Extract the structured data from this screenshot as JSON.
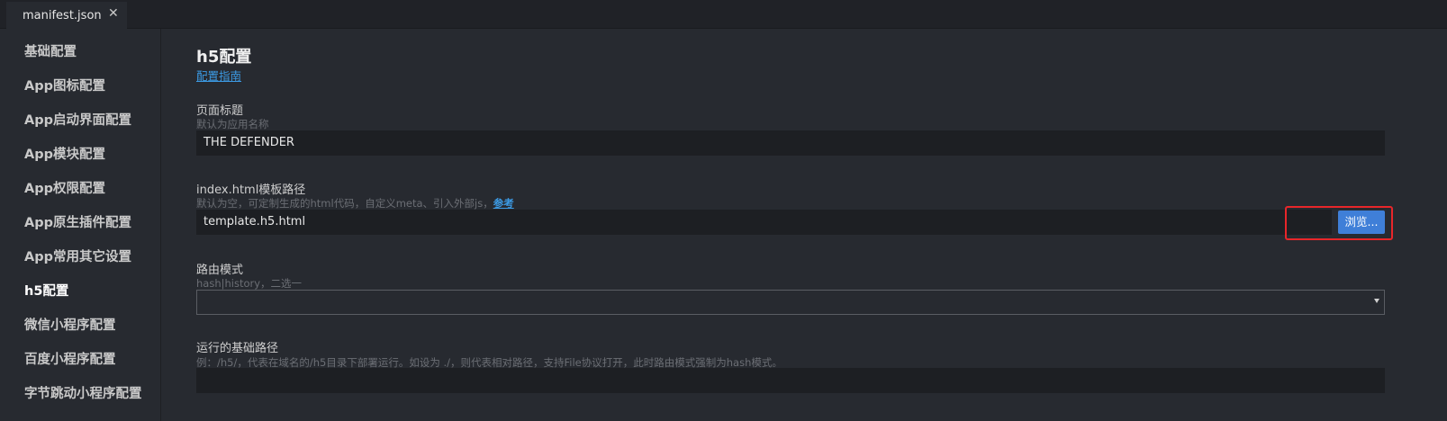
{
  "tabs": [
    {
      "label": "manifest.json",
      "close": "✕"
    }
  ],
  "sidebar": {
    "items": [
      {
        "label": "基础配置"
      },
      {
        "label": "App图标配置"
      },
      {
        "label": "App启动界面配置"
      },
      {
        "label": "App模块配置"
      },
      {
        "label": "App权限配置"
      },
      {
        "label": "App原生插件配置"
      },
      {
        "label": "App常用其它设置"
      },
      {
        "label": "h5配置"
      },
      {
        "label": "微信小程序配置"
      },
      {
        "label": "百度小程序配置"
      },
      {
        "label": "字节跳动小程序配置"
      }
    ],
    "active": "h5配置"
  },
  "main": {
    "title": "h5配置",
    "guide_link": "配置指南",
    "fields": {
      "page_title": {
        "label": "页面标题",
        "hint": "默认为应用名称",
        "value": "THE DEFENDER"
      },
      "template": {
        "label": "index.html模板路径",
        "hint": "默认为空，可定制生成的html代码，自定义meta、引入外部js，",
        "hint_link": "参考",
        "value": "template.h5.html",
        "browse_label": "浏览..."
      },
      "router_mode": {
        "label": "路由模式",
        "hint": "hash|history，二选一",
        "value": ""
      },
      "base_path": {
        "label": "运行的基础路径",
        "hint": "例：/h5/，代表在域名的/h5目录下部署运行。如设为 ./，则代表相对路径，支持File协议打开，此时路由模式强制为hash模式。",
        "value": ""
      }
    }
  },
  "colors": {
    "background": "#272a30",
    "input_background": "#1d1f23",
    "link": "#3c9be5",
    "button": "#3f7fd8",
    "highlight": "#e8262a"
  }
}
